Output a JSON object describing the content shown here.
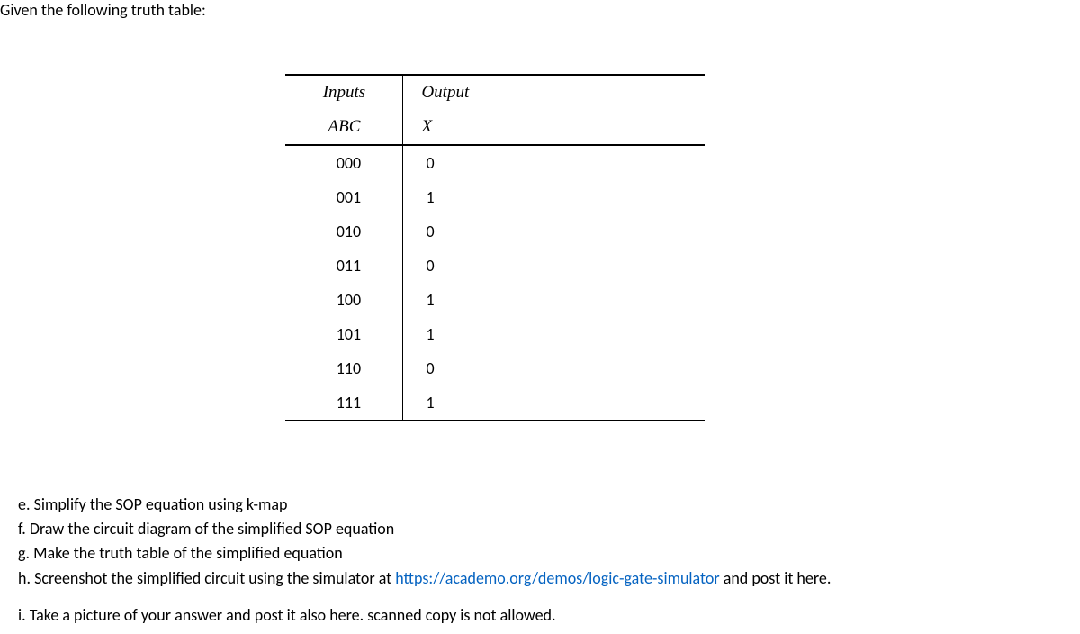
{
  "title": "Given the following truth table:",
  "table": {
    "head1": {
      "inputs": "Inputs",
      "output": "Output"
    },
    "head2": {
      "abc": "ABC",
      "x": "X"
    },
    "rows": [
      {
        "abc": "000",
        "x": "0"
      },
      {
        "abc": "001",
        "x": "1"
      },
      {
        "abc": "010",
        "x": "0"
      },
      {
        "abc": "011",
        "x": "0"
      },
      {
        "abc": "100",
        "x": "1"
      },
      {
        "abc": "101",
        "x": "1"
      },
      {
        "abc": "110",
        "x": "0"
      },
      {
        "abc": "111",
        "x": "1"
      }
    ]
  },
  "questions": {
    "e": "e. Simplify the SOP equation using k-map",
    "f": "f. Draw the circuit diagram of the simplified SOP equation",
    "g": "g. Make the truth table of the simplified equation",
    "h_prefix": "h. Screenshot the simplified circuit using the simulator at ",
    "h_link": "https://academo.org/demos/logic-gate-simulator",
    "h_suffix": " and post it here.",
    "i": "i. Take a picture of your answer and post it also here. scanned copy is not allowed."
  }
}
